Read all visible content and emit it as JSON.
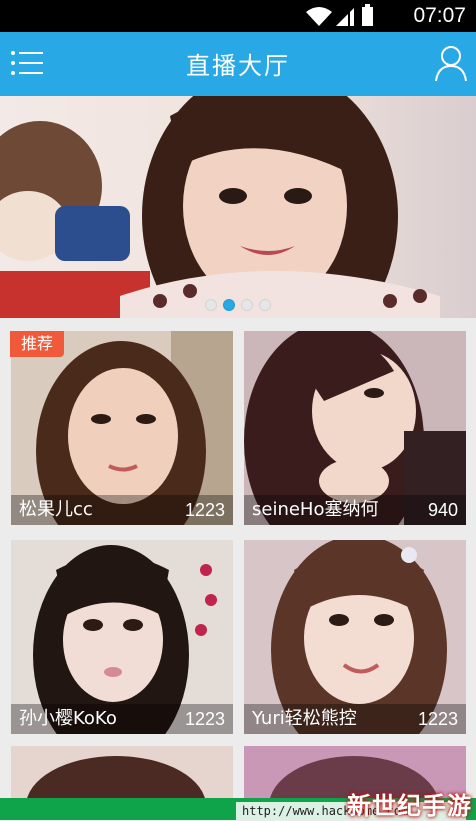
{
  "status_bar": {
    "time": "07:07",
    "icons": [
      "wifi-icon",
      "signal-icon",
      "battery-icon"
    ]
  },
  "header": {
    "title": "直播大厅",
    "menu_icon": "menu-icon",
    "user_icon": "user-icon"
  },
  "banner": {
    "dots": 4,
    "active_dot": 1
  },
  "badge": "推荐",
  "rooms": [
    {
      "name": "松果儿cc",
      "viewers": "1223"
    },
    {
      "name": "seineHo塞纳何",
      "viewers": "940"
    },
    {
      "name": "孙小樱KoKo",
      "viewers": "1223"
    },
    {
      "name": "Yuri轻松熊控",
      "viewers": "1223"
    }
  ],
  "watermark": {
    "url": "http://www.hackhome.com",
    "logo": "新世纪手游"
  },
  "colors": {
    "accent": "#29a8e6",
    "badge": "#f05a3a"
  }
}
